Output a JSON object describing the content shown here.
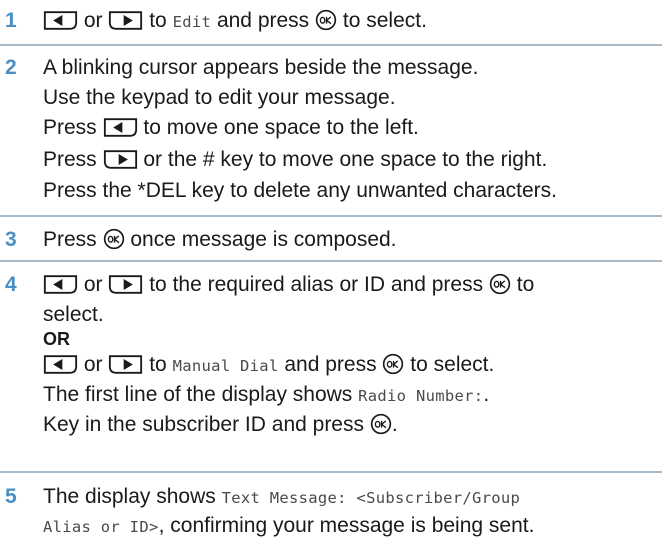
{
  "steps": [
    {
      "number": "1",
      "text": {
        "or": "or",
        "to": "to",
        "target": "Edit",
        "press": "and press",
        "tail": "to select."
      }
    },
    {
      "number": "2",
      "lines": [
        "A blinking cursor appears beside the message.",
        "Use the keypad to edit your message."
      ],
      "left_line": {
        "pre": "Press",
        "post": "to move one space to the left."
      },
      "right_line": {
        "pre": "Press",
        "post": "or the # key to move one space to the right."
      },
      "del_line": "Press the *DEL key to delete any unwanted characters."
    },
    {
      "number": "3",
      "text": {
        "pre": "Press",
        "post": "once message is composed."
      }
    },
    {
      "number": "4",
      "line1": {
        "or": "or",
        "post": "to the required alias or ID and press",
        "tail": "to"
      },
      "line2": "select.",
      "or_label": "OR",
      "line4": {
        "or": "or",
        "to": "to",
        "target": "Manual Dial",
        "press": "and press",
        "tail": "to select."
      },
      "line5": {
        "pre": "The first line of the display shows",
        "value": "Radio Number:",
        "dot": "."
      },
      "line6": {
        "pre": "Key in the subscriber ID and press",
        "dot": "."
      }
    },
    {
      "number": "5",
      "line1": {
        "pre": "The display shows",
        "value": "Text Message: <Subscriber/Group"
      },
      "line2": {
        "value": "Alias or ID>",
        "post": ", confirming your message is being sent."
      }
    }
  ],
  "icons": {
    "left": "left-arrow-key-icon",
    "right": "right-arrow-key-icon",
    "ok": "ok-button-icon"
  }
}
